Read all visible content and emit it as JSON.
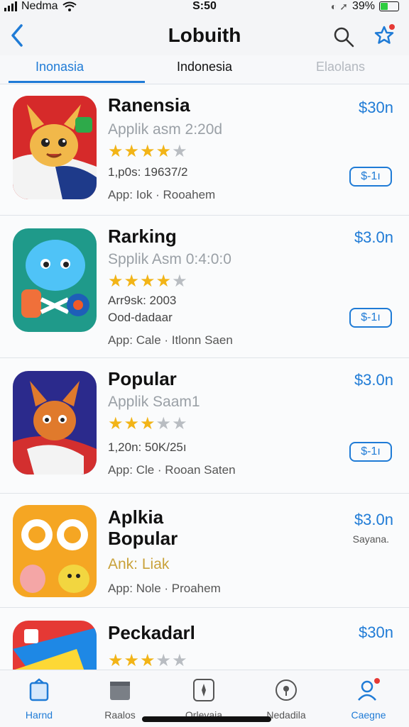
{
  "status": {
    "carrier": "Nedma",
    "time": "S:50",
    "battery": "39%"
  },
  "nav": {
    "title": "Lobuith"
  },
  "tabs": [
    "Inonasia",
    "Indonesia",
    "Elaolans"
  ],
  "apps": [
    {
      "name": "Ranensia",
      "subtitle": "Applik asm 2:20d",
      "rating": 3.5,
      "line1": "1,p0s: 19637/2",
      "category": "App: Iok · Rooahem",
      "price": "$30n",
      "button": "$-1ı"
    },
    {
      "name": "Rarking",
      "subtitle": "Spplik Asm 0:4:0:0",
      "rating": 3.5,
      "line1": "Arr9sk: 2003",
      "line2": "Ood-dadaar",
      "category": "App: Cale · Itlonn Saen",
      "price": "$3.0n",
      "button": "$-1ı"
    },
    {
      "name": "Popular",
      "subtitle": "Applik Saam1",
      "rating": 3,
      "line1": "1,20n: 50K/25ı",
      "category": "App: Cle · Rooan Saten",
      "price": "$3.0n",
      "button": "$-1ı"
    },
    {
      "name": "Aplkia Bopular",
      "name_line1": "Aplkia",
      "name_line2": "Bopular",
      "stars_text": "Ank: Liak",
      "category": "App: Nole · Proahem",
      "price": "$3.0n",
      "price_note": "Sayana."
    },
    {
      "name": "Peckadarl",
      "rating": 2.5,
      "price": "$30n"
    }
  ],
  "tabbar": [
    {
      "label": "Harnd",
      "icon": "home-icon",
      "active": true
    },
    {
      "label": "Raalos",
      "icon": "folder-icon",
      "active": false
    },
    {
      "label": "Orlevaia",
      "icon": "compass-icon",
      "active": false
    },
    {
      "label": "Nedadila",
      "icon": "location-icon",
      "active": false
    },
    {
      "label": "Caegne",
      "icon": "person-icon",
      "active": false
    }
  ],
  "colors": {
    "accent": "#1f7bd6",
    "star": "#f2b417"
  }
}
